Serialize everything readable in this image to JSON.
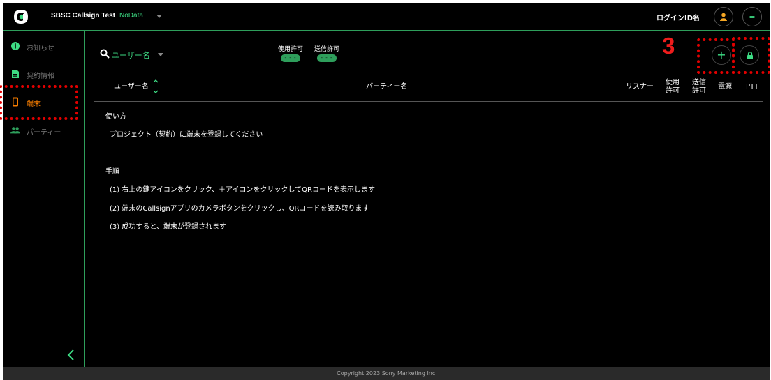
{
  "header": {
    "app_title": "SBSC Callsign Test",
    "project_name": "NoData",
    "login_id": "ログインID名",
    "menu_icon_glyph": "≡"
  },
  "sidebar": {
    "items": [
      {
        "label": "お知らせ",
        "icon": "info-icon"
      },
      {
        "label": "契約情報",
        "icon": "document-icon"
      },
      {
        "label": "端末",
        "icon": "phone-icon"
      },
      {
        "label": "パーティー",
        "icon": "group-icon"
      }
    ],
    "active_index": 2
  },
  "main": {
    "search": {
      "label": "ユーザー名"
    },
    "permissions": [
      {
        "label": "使用許可",
        "value": "- - -"
      },
      {
        "label": "送信許可",
        "value": "- - -"
      }
    ],
    "annotation_number": "3",
    "add_glyph": "+",
    "table_headers": {
      "username": "ユーザー名",
      "party": "パーティー名",
      "listener": "リスナー",
      "use_perm_1": "使用",
      "use_perm_2": "許可",
      "send_perm_1": "送信",
      "send_perm_2": "許可",
      "power": "電源",
      "ptt": "PTT"
    },
    "guide": {
      "usage_title": "使い方",
      "usage_text": "プロジェクト（契約）に端末を登録してください",
      "steps_title": "手順",
      "steps": [
        "(1)  右上の鍵アイコンをクリック、＋アイコンをクリックしてQRコードを表示します",
        "(2)  端末のCallsignアプリのカメラボタンをクリックし、QRコードを読み取ります",
        "(3)  成功すると、端末が登録されます"
      ]
    }
  },
  "footer": {
    "copyright": "Copyright 2023 Sony Marketing Inc."
  },
  "colors": {
    "accent_green": "#3ddc84",
    "divider_green": "#2e9e5b",
    "active_orange": "#f57c00",
    "annotation_red": "#e30000",
    "background": "#000000"
  }
}
